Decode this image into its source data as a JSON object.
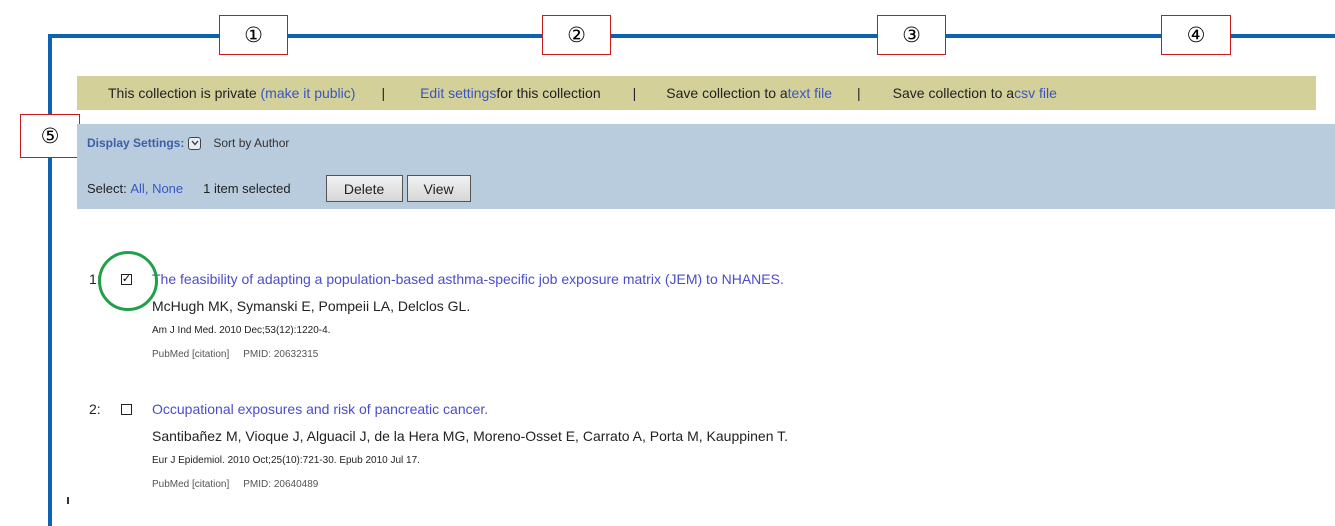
{
  "callouts": [
    "①",
    "②",
    "③",
    "④",
    "⑤"
  ],
  "collection_bar": {
    "private_text": "This collection is private",
    "make_public_link": "(make it public)",
    "separator": "|",
    "edit_settings_link": "Edit settings",
    "edit_settings_suffix": " for this collection",
    "save_text_prefix": "Save collection to a ",
    "text_file_link": "text file",
    "save_csv_prefix": "Save collection to a ",
    "csv_file_link": "csv file"
  },
  "display_settings": {
    "label": "Display Settings:",
    "toggle_icon": "chevron-down-icon",
    "sort_label": "Sort by Author"
  },
  "selection": {
    "label": "Select:",
    "all_link": "All,",
    "none_link": "None",
    "count_text": "1 item selected",
    "delete_button": "Delete",
    "view_button": "View"
  },
  "results": [
    {
      "number": "1:",
      "checked": true,
      "title": "The feasibility of adapting a population-based asthma-specific job exposure matrix (JEM) to NHANES.",
      "authors": "McHugh MK, Symanski E, Pompeii LA, Delclos GL.",
      "journal": "Am J Ind Med. 2010 Dec;53(12):1220-4.",
      "source": "PubMed [citation]",
      "pmid": "PMID: 20632315"
    },
    {
      "number": "2:",
      "checked": false,
      "title": "Occupational exposures and risk of pancreatic cancer.",
      "authors": "Santibañez M, Vioque J, Alguacil J, de la Hera MG, Moreno-Osset E, Carrato A, Porta M, Kauppinen T.",
      "journal": "Eur J Epidemiol. 2010 Oct;25(10):721-30. Epub 2010 Jul 17.",
      "source": "PubMed [citation]",
      "pmid": "PMID: 20640489"
    }
  ],
  "colors": {
    "frame_blue": "#0d62b4",
    "callout_red": "#c8191c",
    "collection_bar_bg": "#d4d09a",
    "settings_panel_bg": "#b9ccdd",
    "link_blue": "#3a55c0",
    "title_purple": "#4b4ccb",
    "highlight_green": "#21a04a"
  }
}
